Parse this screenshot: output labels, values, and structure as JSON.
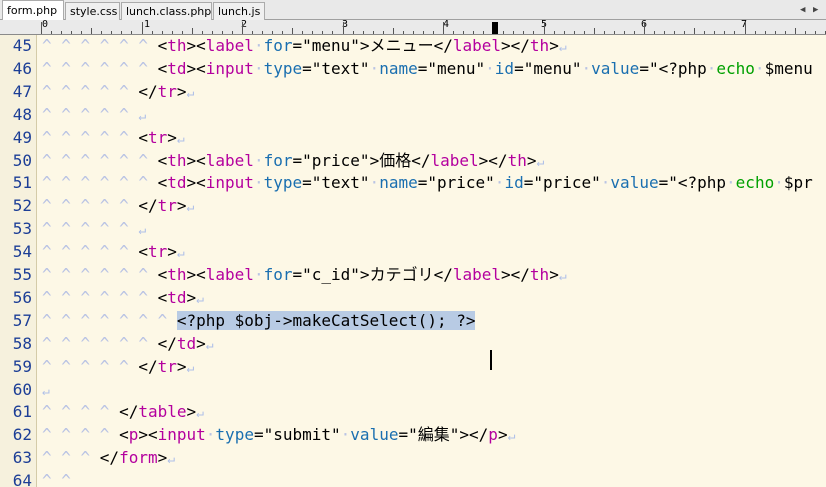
{
  "tabs": [
    {
      "label": "form.php",
      "active": true
    },
    {
      "label": "style.css",
      "active": false
    },
    {
      "label": "lunch.class.php",
      "active": false
    },
    {
      "label": "lunch.js",
      "active": false
    }
  ],
  "scroll_left_glyph": "◀",
  "scroll_right_glyph": "▶",
  "ruler": {
    "labels": [
      "0",
      "1",
      "2",
      "3",
      "4",
      "5",
      "6",
      "7"
    ]
  },
  "colors": {
    "background": "#FDF8E6",
    "line_number": "#1C3E96",
    "tag": "#B4009E",
    "attribute": "#1A6FB0",
    "keyword": "#00A000",
    "whitespace_mark": "#B9C3E4",
    "selection": "#B8CBE4"
  },
  "editor": {
    "lines": [
      {
        "num": "45",
        "tokens": [
          [
            "ws",
            "^ ^ ^ ^ ^ ^ "
          ],
          [
            "br",
            "<"
          ],
          [
            "tg",
            "th"
          ],
          [
            "br",
            "><"
          ],
          [
            "tg",
            "label"
          ],
          [
            "ws",
            "·"
          ],
          [
            "at",
            "for"
          ],
          [
            "op",
            "="
          ],
          [
            "st",
            "\"menu\""
          ],
          [
            "br",
            ">"
          ],
          [
            "tx",
            "メニュー"
          ],
          [
            "br",
            "</"
          ],
          [
            "tg",
            "label"
          ],
          [
            "br",
            "></"
          ],
          [
            "tg",
            "th"
          ],
          [
            "br",
            ">"
          ],
          [
            "nl",
            "↵"
          ]
        ]
      },
      {
        "num": "46",
        "tokens": [
          [
            "ws",
            "^ ^ ^ ^ ^ ^ "
          ],
          [
            "br",
            "<"
          ],
          [
            "tg",
            "td"
          ],
          [
            "br",
            "><"
          ],
          [
            "tg",
            "input"
          ],
          [
            "ws",
            "·"
          ],
          [
            "at",
            "type"
          ],
          [
            "op",
            "="
          ],
          [
            "st",
            "\"text\""
          ],
          [
            "ws",
            "·"
          ],
          [
            "at",
            "name"
          ],
          [
            "op",
            "="
          ],
          [
            "st",
            "\"menu\""
          ],
          [
            "ws",
            "·"
          ],
          [
            "at",
            "id"
          ],
          [
            "op",
            "="
          ],
          [
            "st",
            "\"menu\""
          ],
          [
            "ws",
            "·"
          ],
          [
            "at",
            "value"
          ],
          [
            "op",
            "="
          ],
          [
            "st",
            "\"<?php"
          ],
          [
            "ws",
            "·"
          ],
          [
            "kw",
            "echo"
          ],
          [
            "ws",
            "·"
          ],
          [
            "tx",
            "$menu"
          ]
        ]
      },
      {
        "num": "47",
        "tokens": [
          [
            "ws",
            "^ ^ ^ ^ ^ "
          ],
          [
            "br",
            "</"
          ],
          [
            "tg",
            "tr"
          ],
          [
            "br",
            ">"
          ],
          [
            "nl",
            "↵"
          ]
        ]
      },
      {
        "num": "48",
        "tokens": [
          [
            "ws",
            "^ ^ ^ ^ ^ "
          ],
          [
            "nl",
            "↵"
          ]
        ]
      },
      {
        "num": "49",
        "tokens": [
          [
            "ws",
            "^ ^ ^ ^ ^ "
          ],
          [
            "br",
            "<"
          ],
          [
            "tg",
            "tr"
          ],
          [
            "br",
            ">"
          ],
          [
            "nl",
            "↵"
          ]
        ]
      },
      {
        "num": "50",
        "tokens": [
          [
            "ws",
            "^ ^ ^ ^ ^ ^ "
          ],
          [
            "br",
            "<"
          ],
          [
            "tg",
            "th"
          ],
          [
            "br",
            "><"
          ],
          [
            "tg",
            "label"
          ],
          [
            "ws",
            "·"
          ],
          [
            "at",
            "for"
          ],
          [
            "op",
            "="
          ],
          [
            "st",
            "\"price\""
          ],
          [
            "br",
            ">"
          ],
          [
            "tx",
            "価格"
          ],
          [
            "br",
            "</"
          ],
          [
            "tg",
            "label"
          ],
          [
            "br",
            "></"
          ],
          [
            "tg",
            "th"
          ],
          [
            "br",
            ">"
          ],
          [
            "nl",
            "↵"
          ]
        ]
      },
      {
        "num": "51",
        "tokens": [
          [
            "ws",
            "^ ^ ^ ^ ^ ^ "
          ],
          [
            "br",
            "<"
          ],
          [
            "tg",
            "td"
          ],
          [
            "br",
            "><"
          ],
          [
            "tg",
            "input"
          ],
          [
            "ws",
            "·"
          ],
          [
            "at",
            "type"
          ],
          [
            "op",
            "="
          ],
          [
            "st",
            "\"text\""
          ],
          [
            "ws",
            "·"
          ],
          [
            "at",
            "name"
          ],
          [
            "op",
            "="
          ],
          [
            "st",
            "\"price\""
          ],
          [
            "ws",
            "·"
          ],
          [
            "at",
            "id"
          ],
          [
            "op",
            "="
          ],
          [
            "st",
            "\"price\""
          ],
          [
            "ws",
            "·"
          ],
          [
            "at",
            "value"
          ],
          [
            "op",
            "="
          ],
          [
            "st",
            "\"<?php"
          ],
          [
            "ws",
            "·"
          ],
          [
            "kw",
            "echo"
          ],
          [
            "ws",
            "·"
          ],
          [
            "tx",
            "$pr"
          ]
        ]
      },
      {
        "num": "52",
        "tokens": [
          [
            "ws",
            "^ ^ ^ ^ ^ "
          ],
          [
            "br",
            "</"
          ],
          [
            "tg",
            "tr"
          ],
          [
            "br",
            ">"
          ],
          [
            "nl",
            "↵"
          ]
        ]
      },
      {
        "num": "53",
        "tokens": [
          [
            "ws",
            "^ ^ ^ ^ ^ "
          ],
          [
            "nl",
            "↵"
          ]
        ]
      },
      {
        "num": "54",
        "tokens": [
          [
            "ws",
            "^ ^ ^ ^ ^ "
          ],
          [
            "br",
            "<"
          ],
          [
            "tg",
            "tr"
          ],
          [
            "br",
            ">"
          ],
          [
            "nl",
            "↵"
          ]
        ]
      },
      {
        "num": "55",
        "tokens": [
          [
            "ws",
            "^ ^ ^ ^ ^ ^ "
          ],
          [
            "br",
            "<"
          ],
          [
            "tg",
            "th"
          ],
          [
            "br",
            "><"
          ],
          [
            "tg",
            "label"
          ],
          [
            "ws",
            "·"
          ],
          [
            "at",
            "for"
          ],
          [
            "op",
            "="
          ],
          [
            "st",
            "\"c_id\""
          ],
          [
            "br",
            ">"
          ],
          [
            "tx",
            "カテゴリ"
          ],
          [
            "br",
            "</"
          ],
          [
            "tg",
            "label"
          ],
          [
            "br",
            "></"
          ],
          [
            "tg",
            "th"
          ],
          [
            "br",
            ">"
          ],
          [
            "nl",
            "↵"
          ]
        ]
      },
      {
        "num": "56",
        "tokens": [
          [
            "ws",
            "^ ^ ^ ^ ^ ^ "
          ],
          [
            "br",
            "<"
          ],
          [
            "tg",
            "td"
          ],
          [
            "br",
            ">"
          ],
          [
            "nl",
            "↵"
          ]
        ]
      },
      {
        "num": "57",
        "tokens": [
          [
            "ws",
            "^ ^ ^ ^ ^ ^ ^ "
          ],
          [
            "sel",
            "<?php $obj->makeCatSelect(); ?>"
          ]
        ]
      },
      {
        "num": "58",
        "tokens": [
          [
            "ws",
            "^ ^ ^ ^ ^ ^ "
          ],
          [
            "br",
            "</"
          ],
          [
            "tg",
            "td"
          ],
          [
            "br",
            ">"
          ],
          [
            "nl",
            "↵"
          ]
        ]
      },
      {
        "num": "59",
        "tokens": [
          [
            "ws",
            "^ ^ ^ ^ ^ "
          ],
          [
            "br",
            "</"
          ],
          [
            "tg",
            "tr"
          ],
          [
            "br",
            ">"
          ],
          [
            "nl",
            "↵"
          ]
        ]
      },
      {
        "num": "60",
        "tokens": [
          [
            "nl",
            "↵"
          ]
        ]
      },
      {
        "num": "61",
        "tokens": [
          [
            "ws",
            "^ ^ ^ ^ "
          ],
          [
            "br",
            "</"
          ],
          [
            "tg",
            "table"
          ],
          [
            "br",
            ">"
          ],
          [
            "nl",
            "↵"
          ]
        ]
      },
      {
        "num": "62",
        "tokens": [
          [
            "ws",
            "^ ^ ^ ^ "
          ],
          [
            "br",
            "<"
          ],
          [
            "tg",
            "p"
          ],
          [
            "br",
            "><"
          ],
          [
            "tg",
            "input"
          ],
          [
            "ws",
            "·"
          ],
          [
            "at",
            "type"
          ],
          [
            "op",
            "="
          ],
          [
            "st",
            "\"submit\""
          ],
          [
            "ws",
            "·"
          ],
          [
            "at",
            "value"
          ],
          [
            "op",
            "="
          ],
          [
            "st",
            "\"編集\""
          ],
          [
            "br",
            "></"
          ],
          [
            "tg",
            "p"
          ],
          [
            "br",
            ">"
          ],
          [
            "nl",
            "↵"
          ]
        ]
      },
      {
        "num": "63",
        "tokens": [
          [
            "ws",
            "^ ^ ^ "
          ],
          [
            "br",
            "</"
          ],
          [
            "tg",
            "form"
          ],
          [
            "br",
            ">"
          ],
          [
            "nl",
            "↵"
          ]
        ]
      },
      {
        "num": "64",
        "tokens": [
          [
            "ws",
            "^ ^ "
          ]
        ]
      }
    ]
  }
}
